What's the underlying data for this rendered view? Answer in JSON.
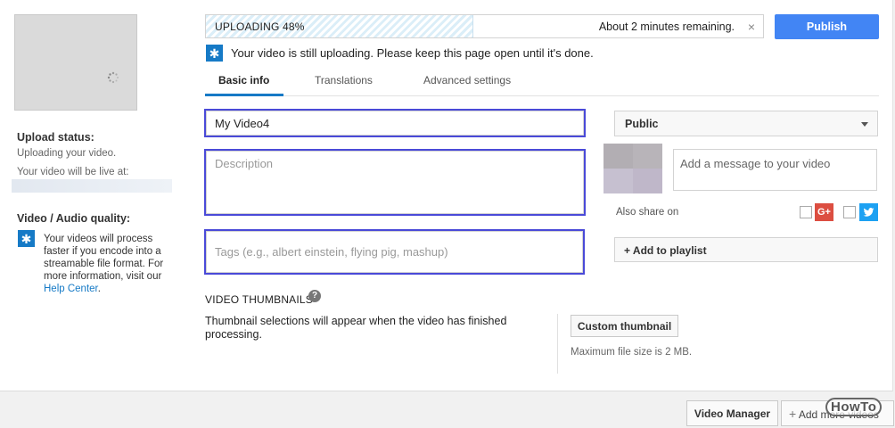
{
  "upload": {
    "status_label": "UPLOADING 48%",
    "progress_fraction": 0.48,
    "remaining": "About 2 minutes remaining.",
    "close_glyph": "×",
    "publish_label": "Publish",
    "notice": "Your video is still uploading. Please keep this page open until it's done."
  },
  "sidebar": {
    "upload_status_heading": "Upload status:",
    "upload_status_text": "Uploading your video.",
    "live_text": "Your video will be live at:",
    "quality_heading": "Video / Audio quality:",
    "quality_text": "Your videos will process faster if you encode into a streamable file format. For more information, visit our",
    "quality_link": "Help Center",
    "quality_end": "."
  },
  "tabs": [
    {
      "label": "Basic info",
      "active": true
    },
    {
      "label": "Translations",
      "active": false
    },
    {
      "label": "Advanced settings",
      "active": false
    }
  ],
  "form": {
    "title_value": "My Video4",
    "description_placeholder": "Description",
    "tags_placeholder": "Tags (e.g., albert einstein, flying pig, mashup)"
  },
  "right": {
    "privacy": "Public",
    "message_placeholder": "Add a message to your video",
    "also_share": "Also share on",
    "gplus_glyph": "G+",
    "add_playlist": "+ Add to playlist"
  },
  "thumbnails": {
    "heading": "VIDEO THUMBNAILS",
    "help_glyph": "?",
    "text": "Thumbnail selections will appear when the video has finished processing.",
    "custom_button": "Custom thumbnail",
    "max_size": "Maximum file size is 2 MB."
  },
  "footer": {
    "video_manager": "Video Manager",
    "add_more_plus": "+",
    "add_more": "Add more videos"
  },
  "watermark": "HowTo",
  "colors": {
    "accent": "#167ac6",
    "publish": "#4285f4",
    "field_focus": "#4a4ad8",
    "gplus": "#dc4e41",
    "twitter": "#1da1f2"
  }
}
